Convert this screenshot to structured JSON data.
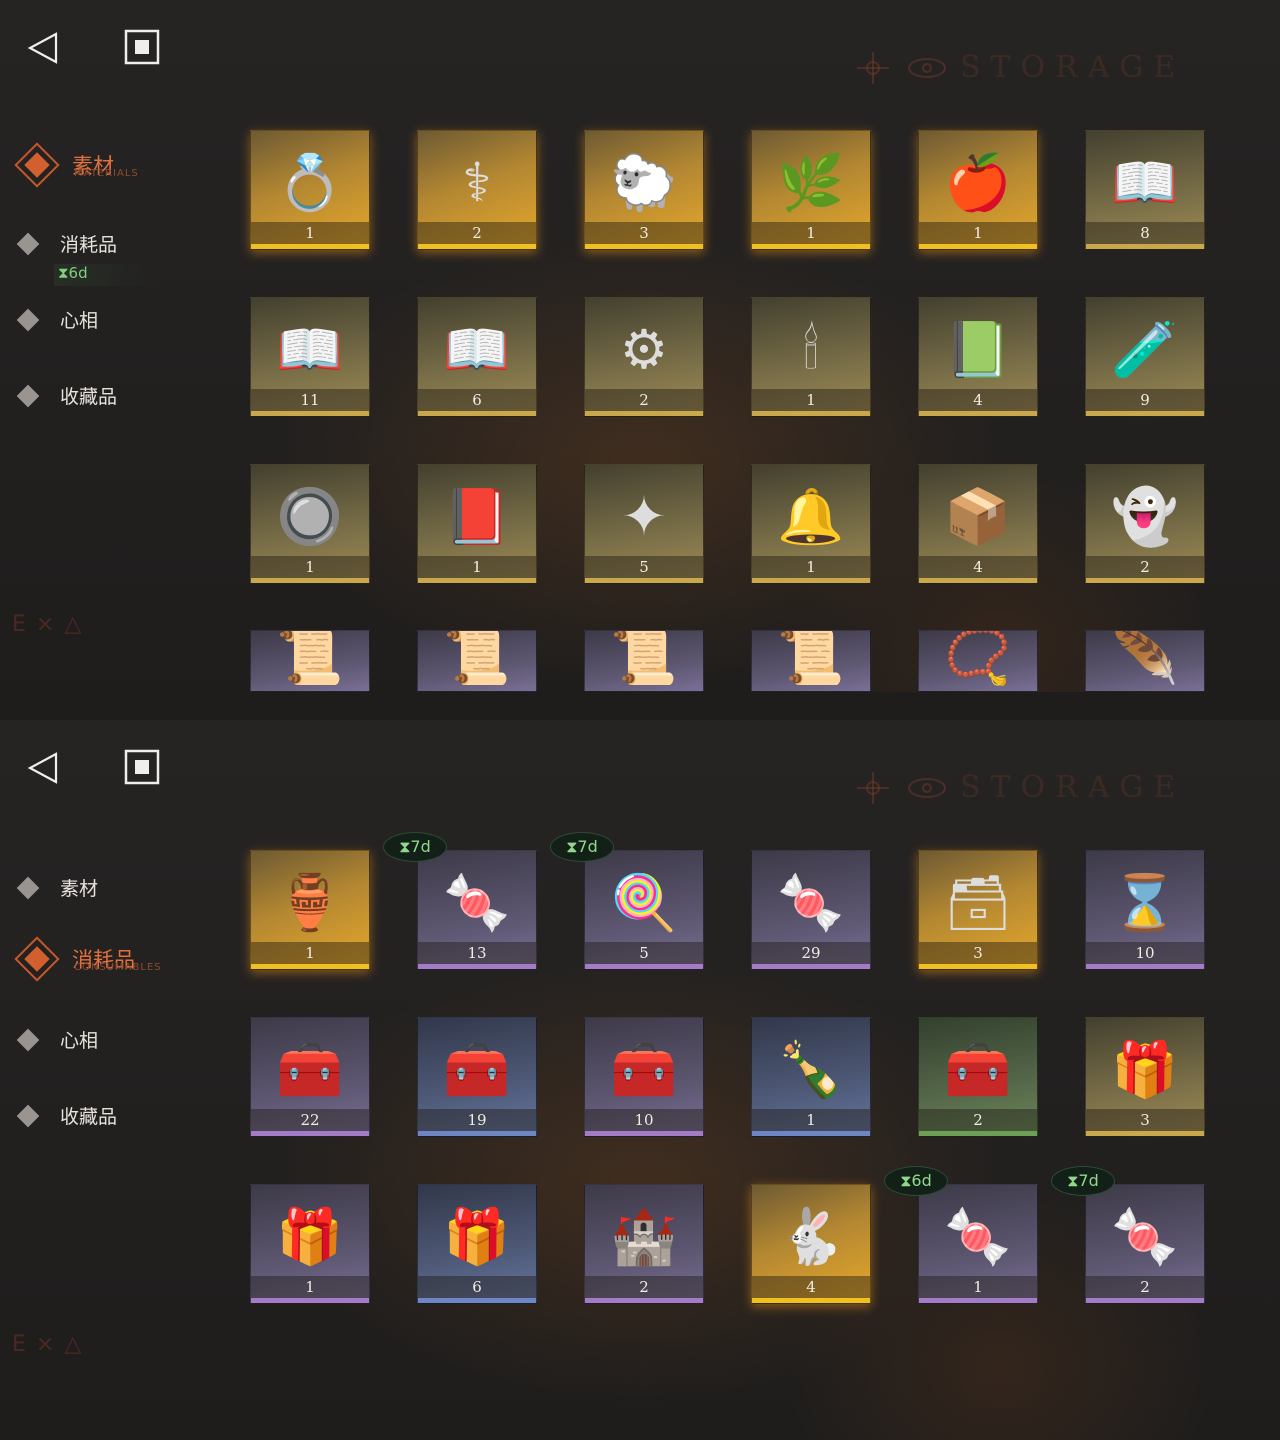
{
  "header": {
    "storage_label": "STORAGE"
  },
  "nav": {
    "materials": "素材",
    "materials_en": "MATERIALS",
    "consumables": "消耗品",
    "consumables_en": "CONSUMABLES",
    "aspects": "心相",
    "collectibles": "收藏品",
    "consumables_timer": "⧗6d"
  },
  "materials_grid": [
    {
      "name": "ornate-ring",
      "icon": "💍",
      "count": "1",
      "rarity": "gold"
    },
    {
      "name": "caduceus",
      "icon": "⚕",
      "count": "2",
      "rarity": "gold"
    },
    {
      "name": "golden-sheep",
      "icon": "🐑",
      "count": "3",
      "rarity": "gold"
    },
    {
      "name": "laurel-wreath",
      "icon": "🌿",
      "count": "1",
      "rarity": "gold"
    },
    {
      "name": "apple-serpent",
      "icon": "🍎",
      "count": "1",
      "rarity": "gold"
    },
    {
      "name": "red-rune-book",
      "icon": "📖",
      "count": "8",
      "rarity": "tan"
    },
    {
      "name": "green-rune-book",
      "icon": "📖",
      "count": "11",
      "rarity": "tan"
    },
    {
      "name": "blue-rune-book",
      "icon": "📖",
      "count": "6",
      "rarity": "tan"
    },
    {
      "name": "astrolabe",
      "icon": "⚙",
      "count": "2",
      "rarity": "tan"
    },
    {
      "name": "ouija-board",
      "icon": "🕯",
      "count": "1",
      "rarity": "tan"
    },
    {
      "name": "green-tablet",
      "icon": "📗",
      "count": "4",
      "rarity": "tan"
    },
    {
      "name": "purple-potion",
      "icon": "🧪",
      "count": "9",
      "rarity": "tan"
    },
    {
      "name": "cipher-disk",
      "icon": "🔘",
      "count": "1",
      "rarity": "tan"
    },
    {
      "name": "dark-tome",
      "icon": "📕",
      "count": "1",
      "rarity": "tan"
    },
    {
      "name": "silver-bullets",
      "icon": "✦",
      "count": "5",
      "rarity": "tan"
    },
    {
      "name": "bell-jar",
      "icon": "🔔",
      "count": "1",
      "rarity": "tan"
    },
    {
      "name": "hand-box",
      "icon": "📦",
      "count": "4",
      "rarity": "tan"
    },
    {
      "name": "ghost",
      "icon": "👻",
      "count": "2",
      "rarity": "tan"
    },
    {
      "name": "red-scroll",
      "icon": "📜",
      "count": "",
      "rarity": "purple"
    },
    {
      "name": "green-scroll",
      "icon": "📜",
      "count": "",
      "rarity": "purple"
    },
    {
      "name": "blue-scroll",
      "icon": "📜",
      "count": "",
      "rarity": "purple"
    },
    {
      "name": "orange-scroll",
      "icon": "📜",
      "count": "",
      "rarity": "purple"
    },
    {
      "name": "amulet",
      "icon": "📿",
      "count": "",
      "rarity": "purple"
    },
    {
      "name": "quill-charm",
      "icon": "🪶",
      "count": "",
      "rarity": "purple"
    }
  ],
  "consumables_grid": [
    {
      "name": "ornament-bauble",
      "icon": "🏺",
      "count": "1",
      "rarity": "gold",
      "timer": ""
    },
    {
      "name": "candy-jar",
      "icon": "🍬",
      "count": "13",
      "rarity": "purple",
      "timer": "⧗7d"
    },
    {
      "name": "lollipops",
      "icon": "🍭",
      "count": "5",
      "rarity": "purple",
      "timer": "⧗7d"
    },
    {
      "name": "candy-jar-2",
      "icon": "🍬",
      "count": "29",
      "rarity": "purple",
      "timer": ""
    },
    {
      "name": "rune-table",
      "icon": "🗃",
      "count": "3",
      "rarity": "gold",
      "timer": ""
    },
    {
      "name": "hourglass",
      "icon": "⌛",
      "count": "10",
      "rarity": "purple",
      "timer": ""
    },
    {
      "name": "wooden-crate-purple",
      "icon": "🧰",
      "count": "22",
      "rarity": "purple",
      "timer": ""
    },
    {
      "name": "wooden-crate-blue",
      "icon": "🧰",
      "count": "19",
      "rarity": "blue",
      "timer": ""
    },
    {
      "name": "wooden-crate-tan",
      "icon": "🧰",
      "count": "10",
      "rarity": "purple",
      "timer": ""
    },
    {
      "name": "message-bottle",
      "icon": "🍾",
      "count": "1",
      "rarity": "blue",
      "timer": ""
    },
    {
      "name": "wooden-crate-green",
      "icon": "🧰",
      "count": "2",
      "rarity": "green",
      "timer": ""
    },
    {
      "name": "parcel-tan",
      "icon": "🎁",
      "count": "3",
      "rarity": "tan",
      "timer": ""
    },
    {
      "name": "parcel-purple",
      "icon": "🎁",
      "count": "1",
      "rarity": "purple",
      "timer": ""
    },
    {
      "name": "parcel-blue",
      "icon": "🎁",
      "count": "6",
      "rarity": "blue",
      "timer": ""
    },
    {
      "name": "sand-castle",
      "icon": "🏰",
      "count": "2",
      "rarity": "purple",
      "timer": ""
    },
    {
      "name": "rabbit-box",
      "icon": "🐇",
      "count": "4",
      "rarity": "gold",
      "timer": ""
    },
    {
      "name": "candies",
      "icon": "🍬",
      "count": "1",
      "rarity": "purple",
      "timer": "⧗6d"
    },
    {
      "name": "candies-2",
      "icon": "🍬",
      "count": "2",
      "rarity": "purple",
      "timer": "⧗7d"
    }
  ]
}
